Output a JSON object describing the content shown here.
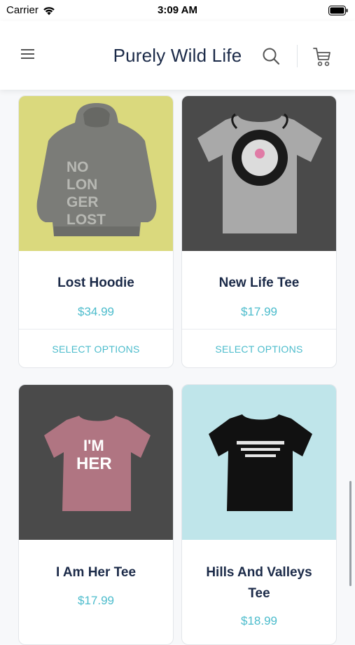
{
  "status_bar": {
    "carrier": "Carrier",
    "time": "3:09 AM"
  },
  "header": {
    "title": "Purely Wild Life"
  },
  "products": [
    {
      "name": "Lost Hoodie",
      "price": "$34.99",
      "action": "SELECT OPTIONS",
      "image_text": [
        "NO",
        "LON",
        "GER",
        "LOST"
      ]
    },
    {
      "name": "New Life Tee",
      "price": "$17.99",
      "action": "SELECT OPTIONS"
    },
    {
      "name": "I Am Her Tee",
      "price": "$17.99",
      "image_text": [
        "I'M",
        "HER"
      ]
    },
    {
      "name_lines": [
        "Hills And Valleys",
        "Tee"
      ],
      "price": "$18.99"
    }
  ],
  "colors": {
    "accent": "#4cbccc",
    "title": "#1b2a48",
    "hoodie_bg": "#dad97d",
    "dark_bg": "#4a4a4a",
    "teal_bg": "#bfe5ea"
  }
}
